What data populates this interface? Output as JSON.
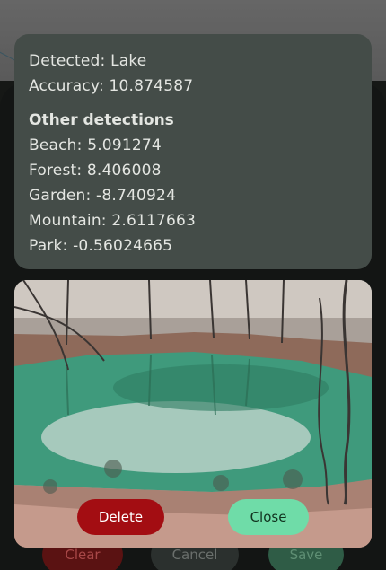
{
  "result": {
    "detected": "Detected: Lake",
    "accuracy": "Accuracy: 10.874587",
    "other_heading": "Other detections",
    "others": [
      "Beach: 5.091274",
      "Forest: 8.406008",
      "Garden: -8.740924",
      "Mountain: 2.6117663",
      "Park: -0.56024665"
    ]
  },
  "actions": {
    "delete_label": "Delete",
    "close_label": "Close"
  },
  "background": {
    "clear_label": "Clear",
    "cancel_label": "Cancel",
    "save_label": "Save"
  },
  "colors": {
    "delete": "#a30d12",
    "close": "#6fdca8",
    "panel": "#444c48"
  }
}
